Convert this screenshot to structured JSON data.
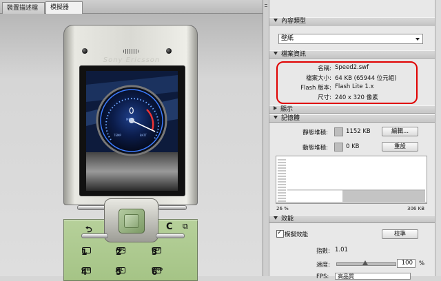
{
  "tabs": [
    {
      "label": "裝置描述檔",
      "active": false
    },
    {
      "label": "模擬器",
      "active": true
    }
  ],
  "device": {
    "brand": "Sony Ericsson",
    "gauge_value": "0",
    "gauge_unit": "MPH",
    "gauge_label_left": "TEMP",
    "gauge_label_right": "BATT",
    "key_back_symbol": "⮌",
    "key_c_label": "C",
    "keys": [
      {
        "num": "1",
        "sub": ""
      },
      {
        "num": "2",
        "sub": "ABC"
      },
      {
        "num": "3",
        "sub": "DEF"
      },
      {
        "num": "4",
        "sub": "GHI"
      },
      {
        "num": "5",
        "sub": "JKL"
      },
      {
        "num": "6",
        "sub": "MNO"
      }
    ]
  },
  "panel": {
    "content_type": {
      "header": "內容類型",
      "selected": "壁紙"
    },
    "file_info": {
      "header": "檔案資訊",
      "rows": [
        {
          "key": "名稱:",
          "value": "Speed2.swf"
        },
        {
          "key": "檔案大小:",
          "value": "64 KB (65944 位元組)"
        },
        {
          "key": "Flash 版本:",
          "value": "Flash Lite 1.x"
        },
        {
          "key": "尺寸:",
          "value": "240 x 320 像素"
        }
      ]
    },
    "display": {
      "header": "顯示"
    },
    "memory": {
      "header": "記憶體",
      "static_heap_label": "靜態堆積:",
      "static_heap_value": "1152 KB",
      "dynamic_heap_label": "動態堆積:",
      "dynamic_heap_value": "0 KB",
      "edit_button": "編輯...",
      "reset_button": "重設",
      "graph_left_label": "26 %",
      "graph_right_label": "306 KB",
      "graph_fill_fraction": 0.26
    },
    "performance": {
      "header": "效能",
      "emulate_label": "模擬效能",
      "emulate_checked": true,
      "calibrate_button": "校準",
      "factor_label": "指數:",
      "factor_value": "1.01",
      "speed_label": "速度:",
      "speed_value": "100",
      "speed_unit": "%",
      "speed_fraction": 0.45,
      "frame_label": "FPS:",
      "frame_value": "高品質"
    }
  }
}
